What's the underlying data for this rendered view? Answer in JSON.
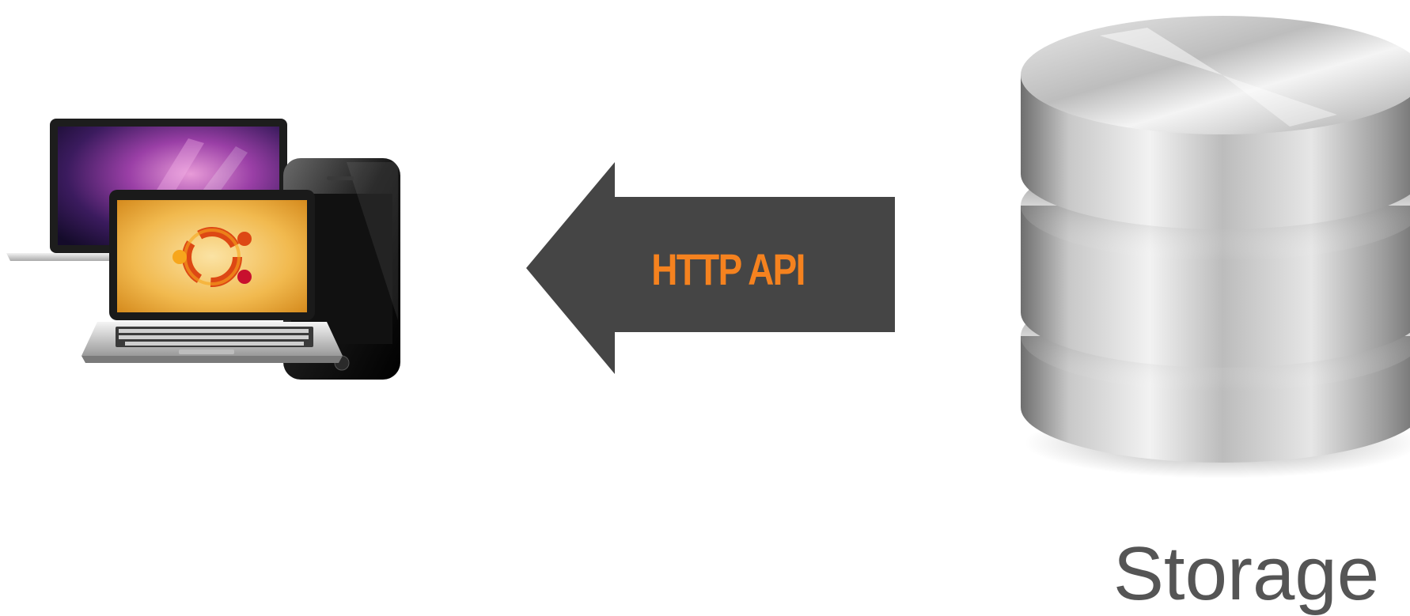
{
  "diagram": {
    "connector_label": "HTTP API",
    "target_label": "Storage",
    "client_devices": [
      "laptop",
      "phone",
      "netbook"
    ],
    "colors": {
      "arrow": "#454545",
      "connector_label": "#f5821f",
      "target_label": "#555555",
      "background": "#ffffff"
    },
    "icons": {
      "client": "devices-icon",
      "arrow": "arrow-left-icon",
      "storage": "database-icon",
      "os_logo": "ubuntu-logo-icon"
    }
  }
}
